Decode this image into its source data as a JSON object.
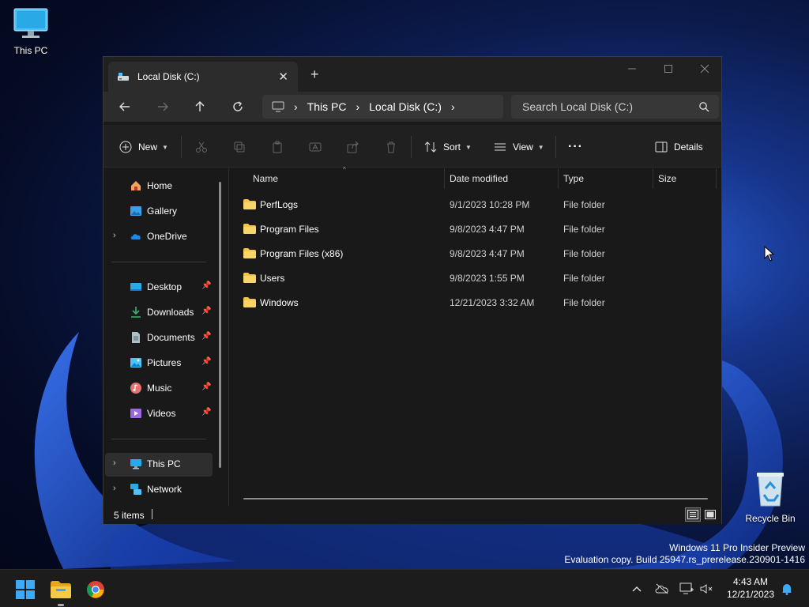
{
  "desktop": {
    "this_pc_label": "This PC",
    "recycle_bin_label": "Recycle Bin",
    "watermark_line1": "Windows 11 Pro Insider Preview",
    "watermark_line2": "Evaluation copy. Build 25947.rs_prerelease.230901-1416"
  },
  "window": {
    "tab_title": "Local Disk (C:)",
    "breadcrumbs": [
      "This PC",
      "Local Disk (C:)"
    ],
    "search_placeholder": "Search Local Disk (C:)"
  },
  "toolbar": {
    "new_label": "New",
    "sort_label": "Sort",
    "view_label": "View",
    "more_label": "···",
    "details_label": "Details"
  },
  "sidebar": {
    "items": [
      {
        "label": "Home"
      },
      {
        "label": "Gallery"
      },
      {
        "label": "OneDrive"
      },
      {
        "label": "Desktop"
      },
      {
        "label": "Downloads"
      },
      {
        "label": "Documents"
      },
      {
        "label": "Pictures"
      },
      {
        "label": "Music"
      },
      {
        "label": "Videos"
      },
      {
        "label": "This PC"
      },
      {
        "label": "Network"
      }
    ]
  },
  "filelist": {
    "columns": {
      "name": "Name",
      "date": "Date modified",
      "type": "Type",
      "size": "Size"
    },
    "rows": [
      {
        "name": "PerfLogs",
        "date": "9/1/2023 10:28 PM",
        "type": "File folder"
      },
      {
        "name": "Program Files",
        "date": "9/8/2023 4:47 PM",
        "type": "File folder"
      },
      {
        "name": "Program Files (x86)",
        "date": "9/8/2023 4:47 PM",
        "type": "File folder"
      },
      {
        "name": "Users",
        "date": "9/8/2023 1:55 PM",
        "type": "File folder"
      },
      {
        "name": "Windows",
        "date": "12/21/2023 3:32 AM",
        "type": "File folder"
      }
    ]
  },
  "status": {
    "item_count": "5 items"
  },
  "taskbar": {
    "time": "4:43 AM",
    "date": "12/21/2023"
  },
  "colors": {
    "folder": "#f2c44b",
    "accent": "#0078d4"
  }
}
